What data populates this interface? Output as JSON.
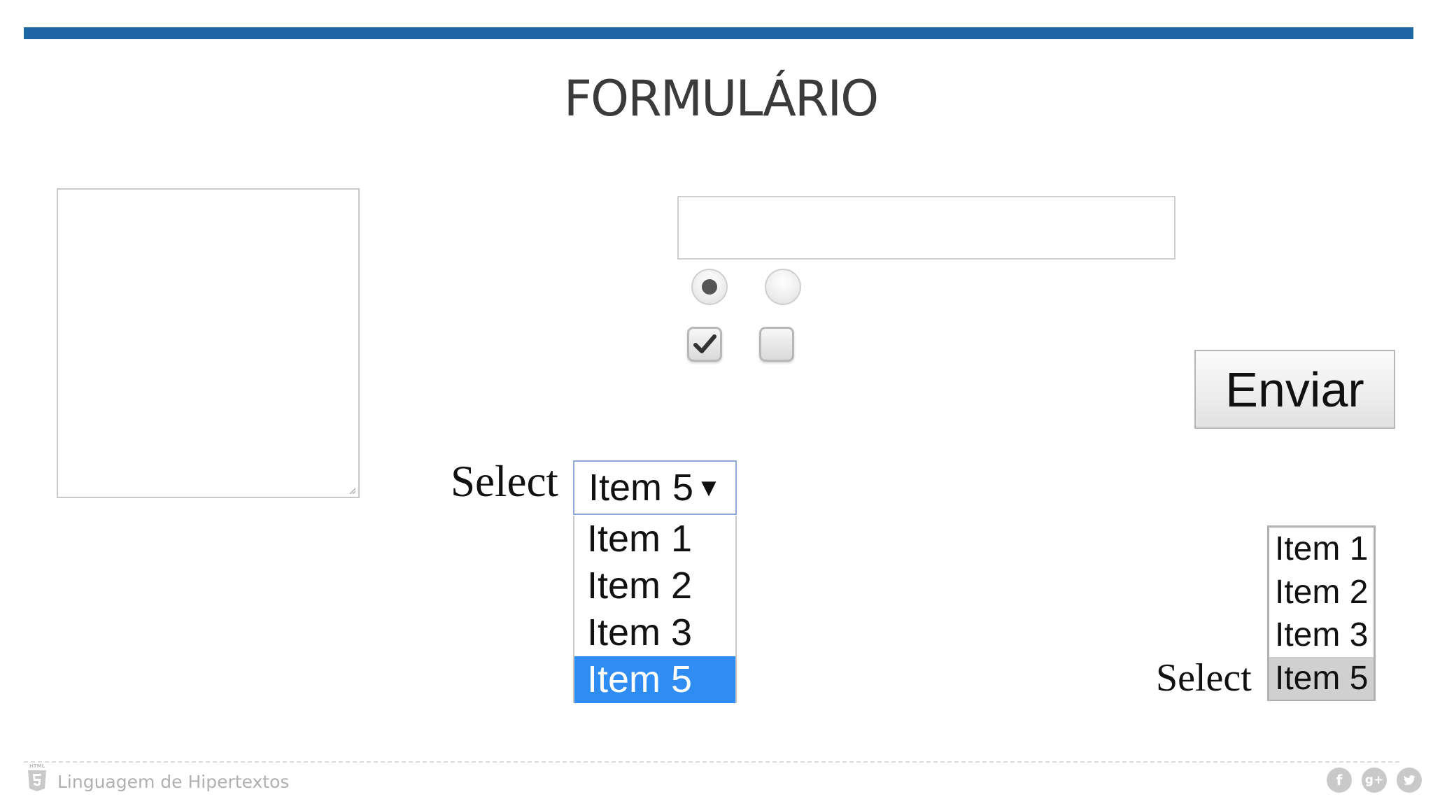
{
  "slide": {
    "title": "FORMULÁRIO",
    "accent_color": "#1f66a4"
  },
  "form": {
    "textarea": {
      "value": ""
    },
    "text_input": {
      "value": ""
    },
    "radios": [
      {
        "checked": true
      },
      {
        "checked": false
      }
    ],
    "checkboxes": [
      {
        "checked": true
      },
      {
        "checked": false
      }
    ],
    "submit_label": "Enviar"
  },
  "dropdown": {
    "label": "Select",
    "selected_value": "Item 5",
    "arrow": "▼",
    "options": [
      "Item 1",
      "Item 2",
      "Item 3",
      "Item 5"
    ],
    "highlighted_option": "Item 5",
    "highlight_color": "#2f8cf2"
  },
  "listbox": {
    "label": "Select",
    "options": [
      "Item 1",
      "Item 2",
      "Item 3",
      "Item 5"
    ],
    "selected_option": "Item 5"
  },
  "footer": {
    "logo_text": "HTML",
    "text": "Linguagem de Hipertextos",
    "social": [
      {
        "icon": "facebook-icon",
        "glyph": "f"
      },
      {
        "icon": "google-plus-icon",
        "glyph": "g+"
      },
      {
        "icon": "twitter-icon",
        "glyph": "t"
      }
    ]
  }
}
